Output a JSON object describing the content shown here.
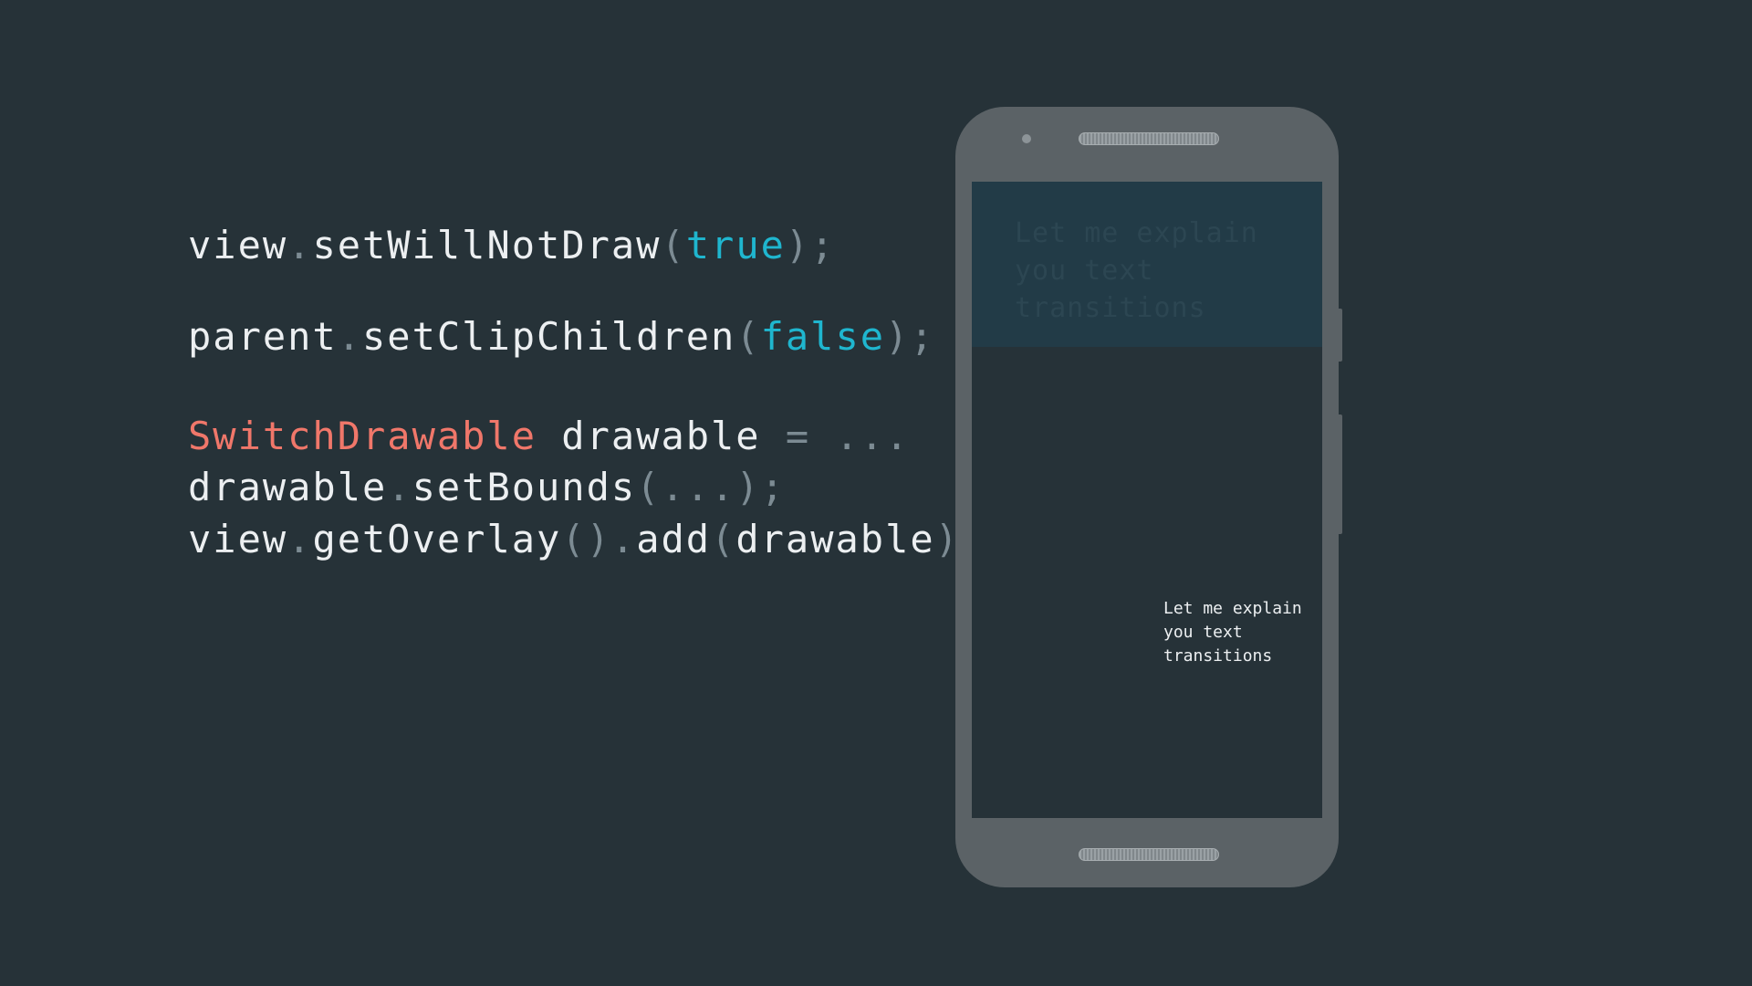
{
  "code": {
    "line1": {
      "obj": "view",
      "dot": ".",
      "method": "setWillNotDraw",
      "open": "(",
      "arg": "true",
      "close": ");"
    },
    "line2": {
      "obj": "parent",
      "dot": ".",
      "method": "setClipChildren",
      "open": "(",
      "arg": "false",
      "close": ");"
    },
    "line3": {
      "type": "SwitchDrawable",
      "var": " drawable ",
      "rest": "= ..."
    },
    "line4": {
      "obj": "drawable",
      "dot": ".",
      "method": "setBounds",
      "args": "(...);"
    },
    "line5": {
      "obj": "view",
      "dot1": ".",
      "method1": "getOverlay",
      "parens": "()",
      "dot2": ".",
      "method2": "add",
      "open": "(",
      "arg": "drawable",
      "close": ");"
    }
  },
  "phone": {
    "header_text": "Let me explain you text transitions",
    "small_text": "Let me explain you text transitions"
  },
  "colors": {
    "background": "#263238",
    "identifier": "#eceff1",
    "punctuation": "#7c8b93",
    "keyword": "#1fb6cf",
    "type": "#f0776a",
    "phone_body": "#5b6266",
    "screen_header": "#223b47"
  }
}
